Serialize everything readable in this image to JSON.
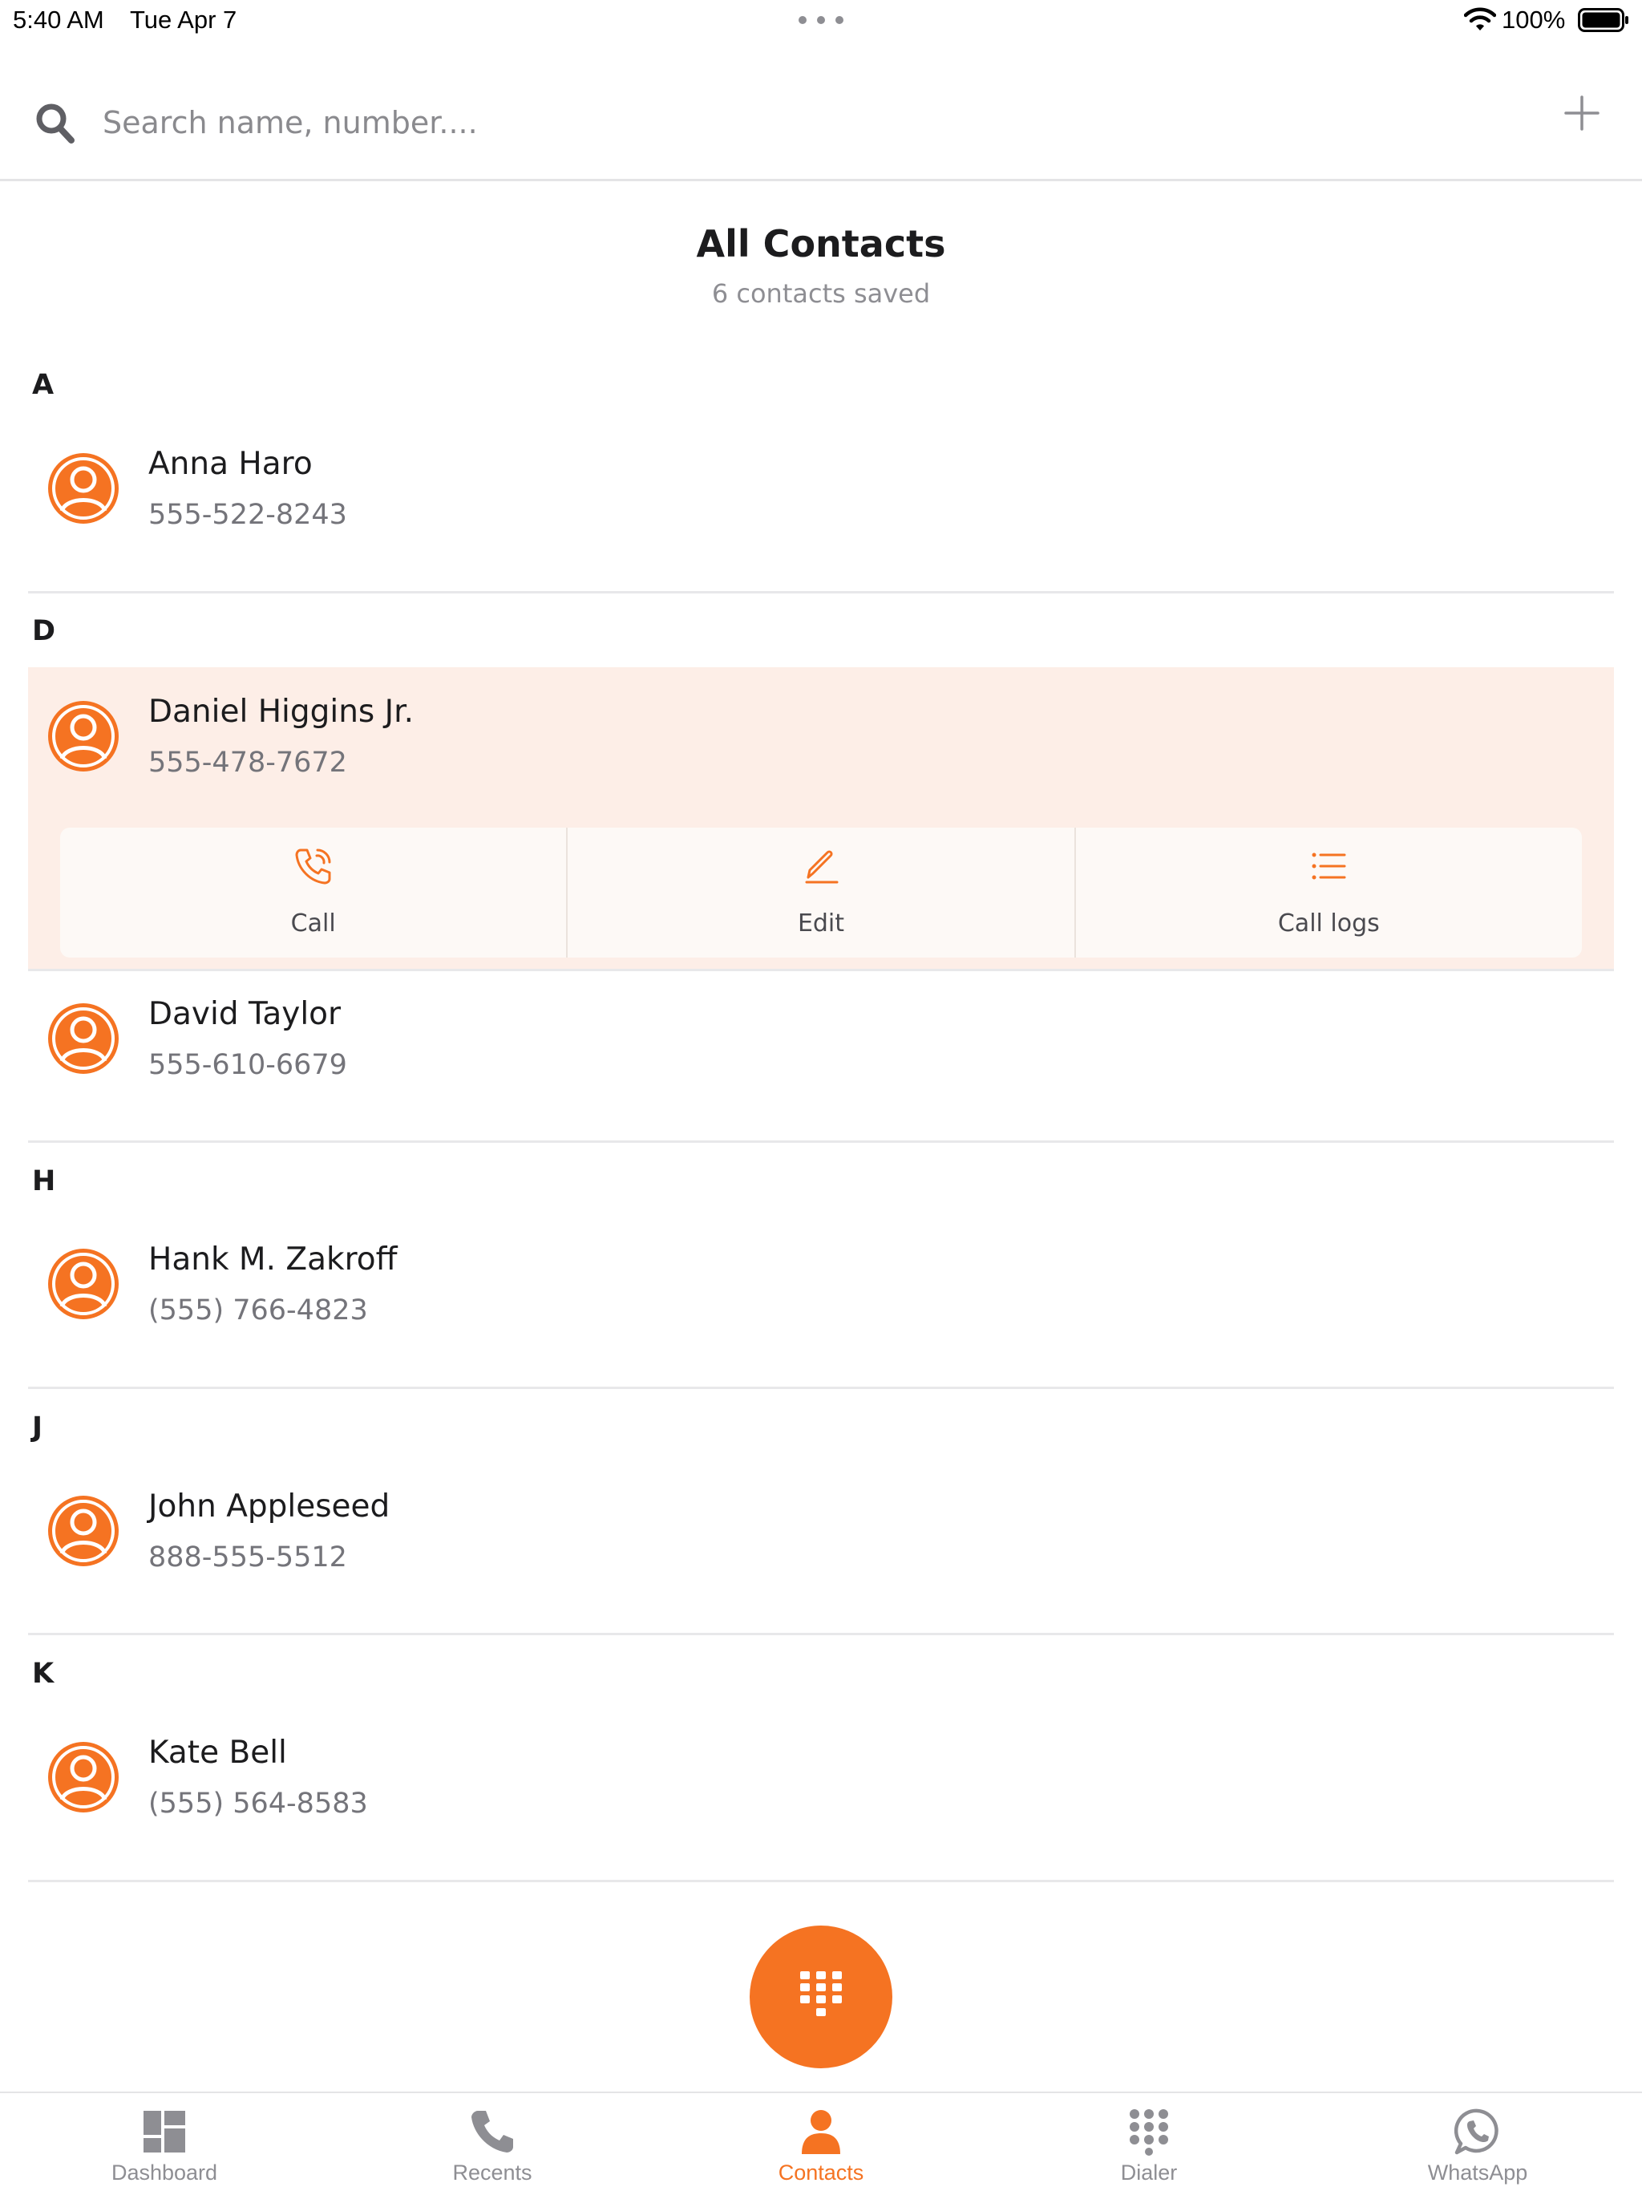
{
  "status_bar": {
    "time": "5:40 AM",
    "date": "Tue Apr 7",
    "battery": "100%"
  },
  "search": {
    "placeholder": "Search name, number...."
  },
  "header": {
    "title": "All Contacts",
    "subtitle": "6 contacts saved"
  },
  "sections": [
    {
      "letter": "A",
      "contacts": [
        {
          "name": "Anna Haro",
          "phone": "555-522-8243"
        }
      ]
    },
    {
      "letter": "D",
      "contacts": [
        {
          "name": "Daniel Higgins Jr.",
          "phone": "555-478-7672"
        },
        {
          "name": "David Taylor",
          "phone": "555-610-6679"
        }
      ]
    },
    {
      "letter": "H",
      "contacts": [
        {
          "name": "Hank M. Zakroff",
          "phone": "(555) 766-4823"
        }
      ]
    },
    {
      "letter": "J",
      "contacts": [
        {
          "name": "John Appleseed",
          "phone": "888-555-5512"
        }
      ]
    },
    {
      "letter": "K",
      "contacts": [
        {
          "name": "Kate Bell",
          "phone": "(555) 564-8583"
        }
      ]
    }
  ],
  "contact_actions": {
    "call": "Call",
    "edit": "Edit",
    "call_logs": "Call logs"
  },
  "tabs": [
    {
      "label": "Dashboard",
      "icon": "dashboard-icon"
    },
    {
      "label": "Recents",
      "icon": "phone-icon"
    },
    {
      "label": "Contacts",
      "icon": "person-icon",
      "active": true
    },
    {
      "label": "Dialer",
      "icon": "keypad-icon"
    },
    {
      "label": "WhatsApp",
      "icon": "whatsapp-icon"
    }
  ],
  "colors": {
    "accent": "#f57322",
    "selected_row": "#fdeee7",
    "muted_text": "#8e8e93"
  }
}
